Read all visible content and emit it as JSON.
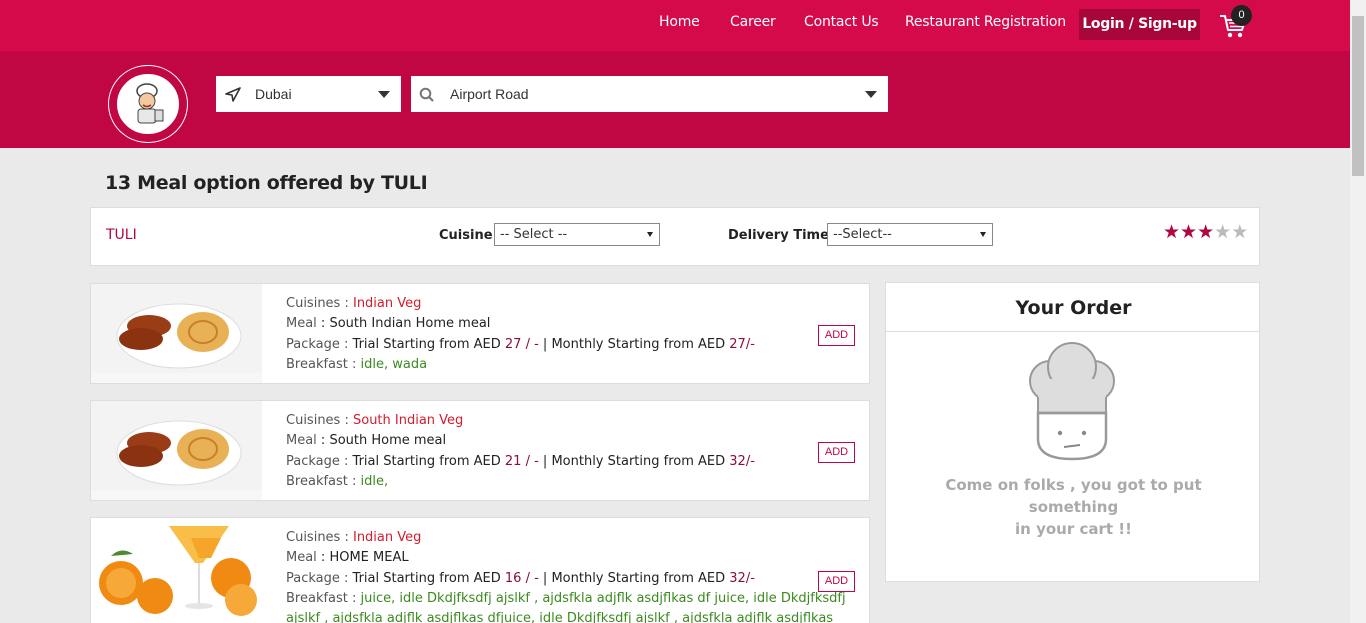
{
  "nav": {
    "links": [
      "Home",
      "Career",
      "Contact Us",
      "Restaurant Registration"
    ],
    "login_label": "Login / Sign-up",
    "cart_count": "0"
  },
  "search": {
    "city": "Dubai",
    "area": "Airport Road"
  },
  "page_title": "13 Meal option offered by TULI",
  "filters": {
    "restaurant": "TULI",
    "cuisine_label": "Cuisine",
    "cuisine_value": "-- Select --",
    "delivery_label": "Delivery Time",
    "delivery_value": "--Select--",
    "rating": 3,
    "rating_max": 5
  },
  "labels": {
    "cuisines": "Cuisines",
    "meal": "Meal",
    "package": "Package",
    "breakfast": "Breakfast",
    "trial": "Trial Starting from AED",
    "monthly": "Monthly Starting from AED",
    "add": "ADD"
  },
  "meals": [
    {
      "cuisine": "Indian Veg",
      "meal": "South Indian Home meal",
      "trial_price": "27 / -",
      "monthly_price": "27/-",
      "breakfast": "idle, wada",
      "image": "vada-plate"
    },
    {
      "cuisine": "South Indian Veg",
      "meal": "South Home meal",
      "trial_price": "21 / -",
      "monthly_price": "32/-",
      "breakfast": "idle,",
      "image": "vada-plate"
    },
    {
      "cuisine": "Indian Veg",
      "meal": "HOME MEAL",
      "trial_price": "16 / -",
      "monthly_price": "32/-",
      "breakfast": "juice, idle Dkdjfksdfj ajslkf , ajdsfkla adjflk asdjflkas df juice, idle Dkdjfksdfj",
      "breakfast_line2": "ajslkf , ajdsfkla adjflk asdjflkas dfjuice, idle Dkdjfksdfj ajslkf , ajdsfkla adjflk asdjflkas",
      "image": "orange-juice"
    }
  ],
  "order": {
    "title": "Your Order",
    "empty_line1": "Come on folks , you got to put something",
    "empty_line2": "in your cart !!"
  },
  "colors": {
    "top_nav": "#d50a4b",
    "header": "#c10743",
    "accent": "#b0073e"
  }
}
